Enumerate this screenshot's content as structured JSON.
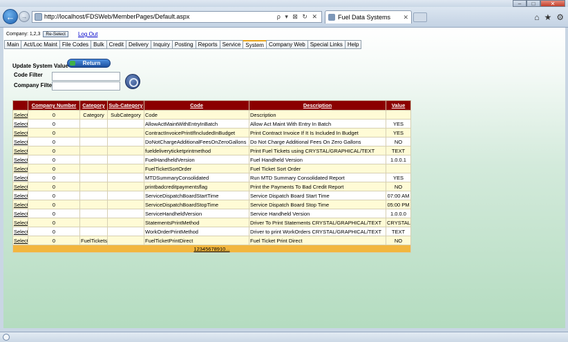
{
  "browser": {
    "url": "http://localhost/FDSWeb/MemberPages/Default.aspx",
    "address_controls": "ρ ▾ ⊠ ↻ ✕",
    "tab_title": "Fuel Data Systems",
    "tab_close": "✕",
    "home_icon": "⌂",
    "favorites_icon": "★",
    "settings_icon": "⚙",
    "back_glyph": "←",
    "forward_glyph": "→",
    "win_min": "–",
    "win_max": "□",
    "win_close": "✕"
  },
  "header": {
    "company_label": "Company: 1,2,3",
    "reselect_label": "Re-Select",
    "logout_label": "Log Out"
  },
  "menu": {
    "items": [
      "Main",
      "Act/Loc Maint",
      "File Codes",
      "Bulk",
      "Credit",
      "Delivery",
      "Inquiry",
      "Posting",
      "Reports",
      "Service",
      "System",
      "Company Web",
      "Special Links",
      "Help"
    ],
    "active": "System"
  },
  "form": {
    "title": "Update System Value",
    "return_label": "Return",
    "code_filter_label": "Code Filter",
    "company_filter_label": "Company Filter",
    "code_filter_value": "",
    "company_filter_value": ""
  },
  "grid": {
    "columns": [
      "",
      "Company Number",
      "Category",
      "Sub-Category",
      "Code",
      "Description",
      "Value"
    ],
    "select_label": "Select",
    "rows": [
      {
        "company": "0",
        "category": "Category",
        "subcategory": "SubCategory",
        "code": "Code",
        "description": "Description",
        "value": ""
      },
      {
        "company": "0",
        "category": "",
        "subcategory": "",
        "code": "AllowActMaintWithEntryInBatch",
        "description": "Allow Act Maint With Entry In Batch",
        "value": "YES"
      },
      {
        "company": "0",
        "category": "",
        "subcategory": "",
        "code": "ContractInvoicePrintIfIncludedInBudget",
        "description": "Print Contract Invoice If It Is Included In Budget",
        "value": "YES"
      },
      {
        "company": "0",
        "category": "",
        "subcategory": "",
        "code": "DoNotChargeAdditionalFeesOnZeroGallons",
        "description": "Do Not Charge Additional Fees On Zero Gallons",
        "value": "NO"
      },
      {
        "company": "0",
        "category": "",
        "subcategory": "",
        "code": "fueldeliveryticketprintmethod",
        "description": "Print Fuel Tickets using CRYSTAL/GRAPHICAL/TEXT",
        "value": "TEXT"
      },
      {
        "company": "0",
        "category": "",
        "subcategory": "",
        "code": "FuelHandheldVersion",
        "description": "Fuel Handheld Version",
        "value": "1.0.0.1"
      },
      {
        "company": "0",
        "category": "",
        "subcategory": "",
        "code": "FuelTicketSortOrder",
        "description": "Fuel Ticket Sort Order",
        "value": ""
      },
      {
        "company": "0",
        "category": "",
        "subcategory": "",
        "code": "MTDSummaryConsolidated",
        "description": "Run MTD Summary Consolidated Report",
        "value": "YES"
      },
      {
        "company": "0",
        "category": "",
        "subcategory": "",
        "code": "printbadcreditpaymentsflag",
        "description": "Print the Payments To Bad Credit Report",
        "value": "NO"
      },
      {
        "company": "0",
        "category": "",
        "subcategory": "",
        "code": "ServiceDispatchBoardStartTime",
        "description": "Service Dispatch Board Start Time",
        "value": "07:00 AM"
      },
      {
        "company": "0",
        "category": "",
        "subcategory": "",
        "code": "ServiceDispatchBoardStopTime",
        "description": "Service Dispatch Board Stop Time",
        "value": "05:00 PM"
      },
      {
        "company": "0",
        "category": "",
        "subcategory": "",
        "code": "ServiceHandheldVersion",
        "description": "Service Handheld Version",
        "value": "1.0.0.0"
      },
      {
        "company": "0",
        "category": "",
        "subcategory": "",
        "code": "StatementsPrintMethod",
        "description": "Driver To Print Statements CRYSTAL/GRAPHICAL/TEXT",
        "value": "CRYSTAL"
      },
      {
        "company": "0",
        "category": "",
        "subcategory": "",
        "code": "WorkOrderPrintMethod",
        "description": "Driver to print WorkOrders CRYSTAL/GRAPHICAL/TEXT",
        "value": "TEXT"
      },
      {
        "company": "0",
        "category": "FuelTickets",
        "subcategory": "",
        "code": "FuelTicketPrintDirect",
        "description": "Fuel Ticket Print Direct",
        "value": "NO"
      }
    ],
    "pager": "12345678910..."
  }
}
